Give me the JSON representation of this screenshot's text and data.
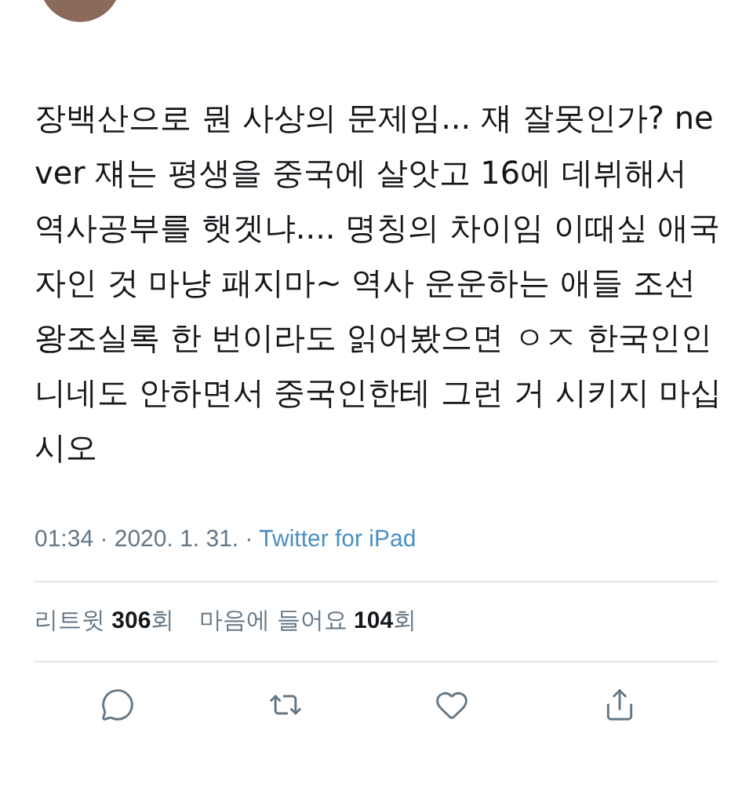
{
  "tweet": {
    "text": "장백산으로 뭔 사상의 문제임... 쟤 잘못인가? never 쟤는 평생을 중국에 살앗고 16에 데뷔해서 역사공부를 햇겟냐.... 명칭의 차이임 이때싶 애국자인 것 마냥 패지마~ 역사 운운하는 애들 조선왕조실록 한 번이라도 읽어봤으면 ㅇㅈ 한국인인 니네도 안하면서 중국인한테 그런 거 시키지 마십시오",
    "time": "01:34 · 2020. 1. 31. · ",
    "source": "Twitter for iPad"
  },
  "stats": [
    {
      "text": "리트윗 **306**회"
    },
    {
      "text": "마음에 들어요 **104**회"
    }
  ],
  "actions": [
    {
      "kind": "reply"
    },
    {
      "kind": "retweet"
    },
    {
      "kind": "like"
    },
    {
      "kind": "share"
    }
  ]
}
